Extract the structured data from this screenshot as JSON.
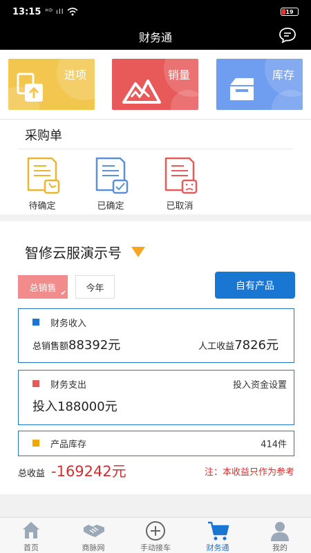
{
  "status_bar": {
    "time": "13:15",
    "signal": "ᴴᴰ ıll",
    "battery": "19"
  },
  "header": {
    "title": "财务通",
    "chat_icon": "chat-bubble-icon"
  },
  "tiles": [
    {
      "label": "进项",
      "color": "#f2c64f",
      "icon": "document-upload-icon"
    },
    {
      "label": "销量",
      "color": "#e85a5a",
      "icon": "mountain-chart-icon"
    },
    {
      "label": "库存",
      "color": "#6f9df0",
      "icon": "box-icon"
    }
  ],
  "purchase": {
    "title": "采购单",
    "statuses": [
      {
        "label": "待确定",
        "icon": "pending-document-icon",
        "color": "#e8b62e"
      },
      {
        "label": "已确定",
        "icon": "confirmed-document-icon",
        "color": "#5b8fd6"
      },
      {
        "label": "已取消",
        "icon": "cancelled-document-icon",
        "color": "#e35b5b"
      }
    ]
  },
  "finance": {
    "company": "智修云服演示号",
    "tabs": {
      "total_sales": "总销售",
      "period": "今年"
    },
    "own_products_button": "自有产品",
    "income": {
      "title": "财务收入",
      "total_sales_label": "总销售额",
      "total_sales_value": "88392元",
      "labor_label": "人工收益",
      "labor_value": "7826元",
      "marker_color": "#1976d2"
    },
    "expense": {
      "title": "财务支出",
      "settings_link": "投入资金设置",
      "invest_label": "投入",
      "invest_value": "188000元",
      "marker_color": "#e35b5b"
    },
    "inventory": {
      "title": "产品库存",
      "count": "414件",
      "marker_color": "#f0a800"
    },
    "profit": {
      "label": "总收益",
      "value": "-169242元",
      "note": "注：本收益只作为参考"
    }
  },
  "bottom_nav": [
    {
      "label": "首页",
      "icon": "home-icon",
      "active": false
    },
    {
      "label": "商脉网",
      "icon": "handshake-icon",
      "active": false
    },
    {
      "label": "手动接车",
      "icon": "add-circle-icon",
      "active": false
    },
    {
      "label": "财务通",
      "icon": "cart-icon",
      "active": true
    },
    {
      "label": "我的",
      "icon": "user-icon",
      "active": false
    }
  ]
}
